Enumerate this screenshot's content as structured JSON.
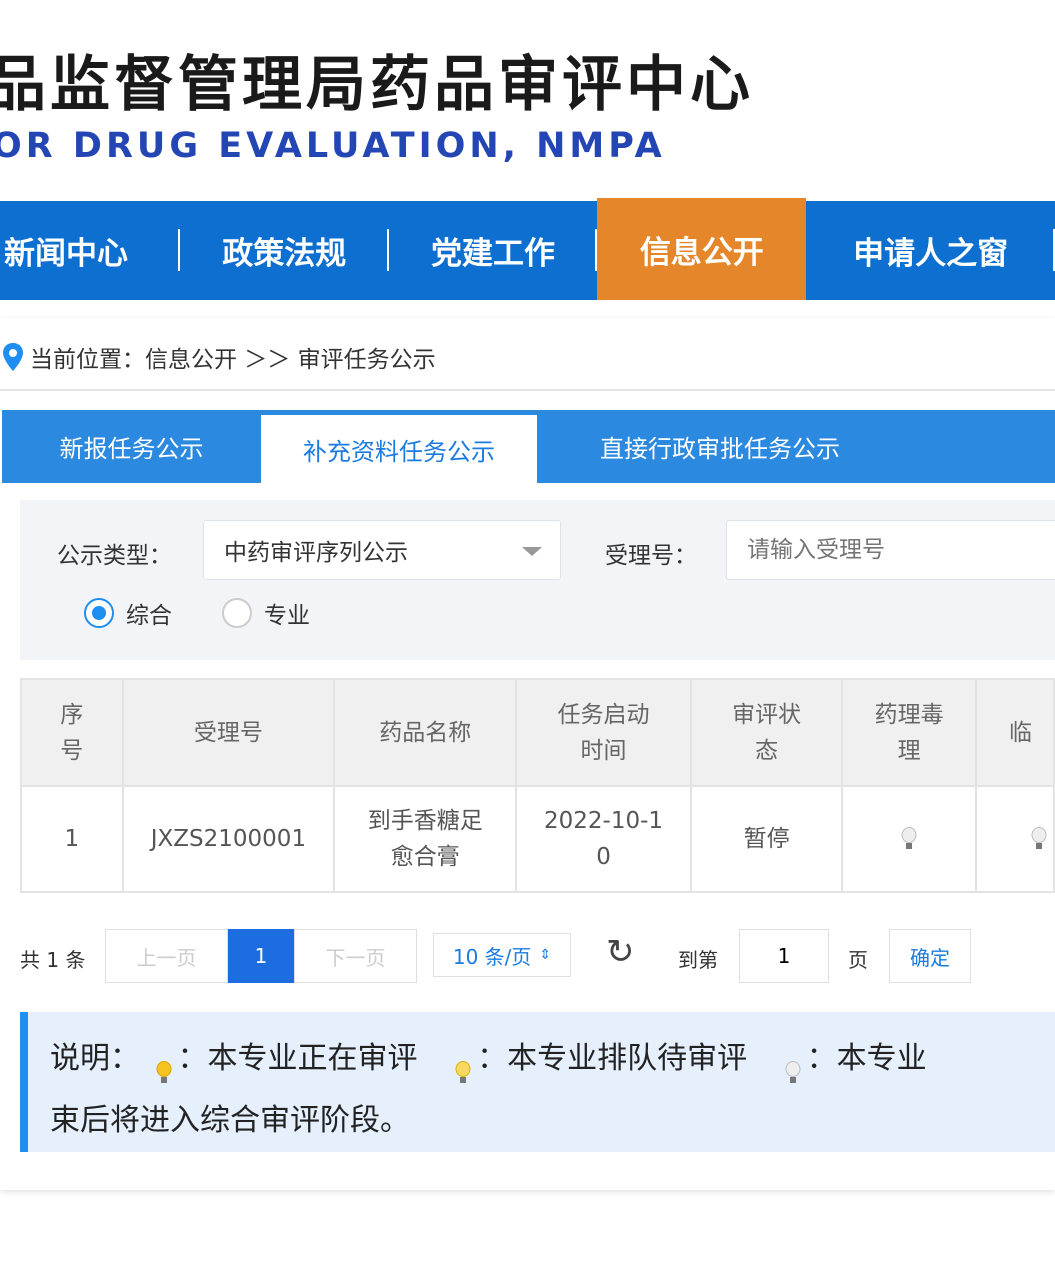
{
  "header": {
    "title": "品监督管理局药品审评中心",
    "subtitle": "OR DRUG EVALUATION, NMPA"
  },
  "nav": [
    "新闻中心",
    "政策法规",
    "党建工作",
    "信息公开",
    "申请人之窗"
  ],
  "breadcrumb": {
    "label": "当前位置：信息公开 ＞＞ 审评任务公示"
  },
  "tabs": [
    "新报任务公示",
    "补充资料任务公示",
    "直接行政审批任务公示"
  ],
  "filter": {
    "type_label": "公示类型：",
    "type_value": "中药审评序列公示",
    "acceptance_label": "受理号：",
    "acceptance_placeholder": "请输入受理号",
    "radio1": "综合",
    "radio2": "专业"
  },
  "table": {
    "headers": [
      "序号",
      "受理号",
      "药品名称",
      "任务启动时间",
      "审评状态",
      "药理毒理",
      "临"
    ],
    "rows": [
      {
        "no": "1",
        "id": "JXZS2100001",
        "name": "到手香糖足愈合膏",
        "date": "2022-10-10",
        "status": "暂停"
      }
    ]
  },
  "pagination": {
    "total": "共 1 条",
    "prev": "上一页",
    "page": "1",
    "next": "下一页",
    "per_page": "10 条/页",
    "goto": "到第",
    "goto_value": "1",
    "page_unit": "页",
    "confirm": "确定"
  },
  "note": {
    "label": "说明：",
    "item1": "：本专业正在审评",
    "item2": "：本专业排队待审评",
    "item3": "：本专业",
    "line2": "束后将进入综合审评阶段。"
  },
  "colors": {
    "nav": "#0d6fd0",
    "active": "#e6862a",
    "accent": "#1c7be0"
  }
}
